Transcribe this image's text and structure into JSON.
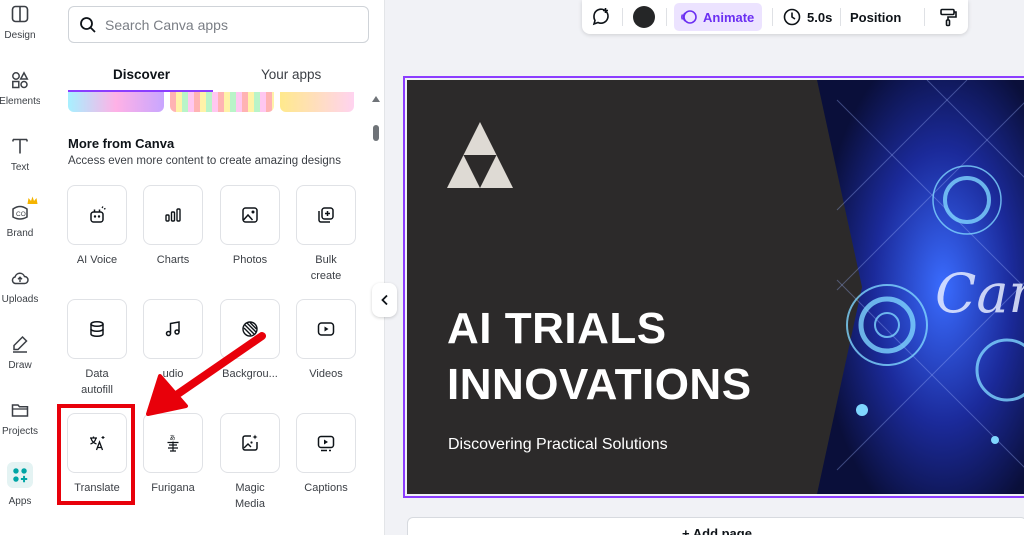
{
  "rail": {
    "items": [
      {
        "label": "Design",
        "icon": "layout-icon"
      },
      {
        "label": "Elements",
        "icon": "shapes-icon"
      },
      {
        "label": "Text",
        "icon": "text-icon"
      },
      {
        "label": "Brand",
        "icon": "brand-icon"
      },
      {
        "label": "Uploads",
        "icon": "cloud-upload-icon"
      },
      {
        "label": "Draw",
        "icon": "pen-icon"
      },
      {
        "label": "Projects",
        "icon": "folder-icon"
      },
      {
        "label": "Apps",
        "icon": "apps-grid-icon"
      }
    ]
  },
  "panel": {
    "search_placeholder": "Search Canva apps",
    "tabs": [
      {
        "label": "Discover",
        "active": true
      },
      {
        "label": "Your apps",
        "active": false
      }
    ],
    "section_title": "More from Canva",
    "section_subtitle": "Access even more content to create amazing designs",
    "tiles": [
      {
        "label": "AI Voice",
        "icon": "ai-voice-icon"
      },
      {
        "label": "Charts",
        "icon": "bar-chart-icon"
      },
      {
        "label": "Photos",
        "icon": "image-icon"
      },
      {
        "label": "Bulk create",
        "icon": "bulk-create-icon"
      },
      {
        "label": "Data autofill",
        "icon": "database-icon"
      },
      {
        "label": "Audio",
        "icon": "music-note-icon"
      },
      {
        "label": "Backgrou...",
        "icon": "background-icon"
      },
      {
        "label": "Videos",
        "icon": "video-play-icon"
      },
      {
        "label": "Translate",
        "icon": "translate-icon"
      },
      {
        "label": "Furigana",
        "icon": "furigana-icon"
      },
      {
        "label": "Magic Media",
        "icon": "magic-media-icon"
      },
      {
        "label": "Captions",
        "icon": "captions-icon"
      }
    ],
    "visible_tile_labels": {
      "audio": "udio",
      "data_line1": "Data",
      "data_line2": "autofill",
      "bulk_line1": "Bulk",
      "bulk_line2": "create",
      "magic_line1": "Magic",
      "magic_line2": "Media"
    }
  },
  "toolbar": {
    "animate_label": "Animate",
    "duration_label": "5.0s",
    "position_label": "Position",
    "color_swatch": "#252627"
  },
  "slide": {
    "title_line1": "AI TRIALS",
    "title_line2": "INNOVATIONS",
    "subtitle": "Discovering Practical Solutions",
    "image_text": "Canva"
  },
  "add_page_label": "+ Add page",
  "colors": {
    "accent": "#8b3dff",
    "highlight": "#e8000a"
  }
}
